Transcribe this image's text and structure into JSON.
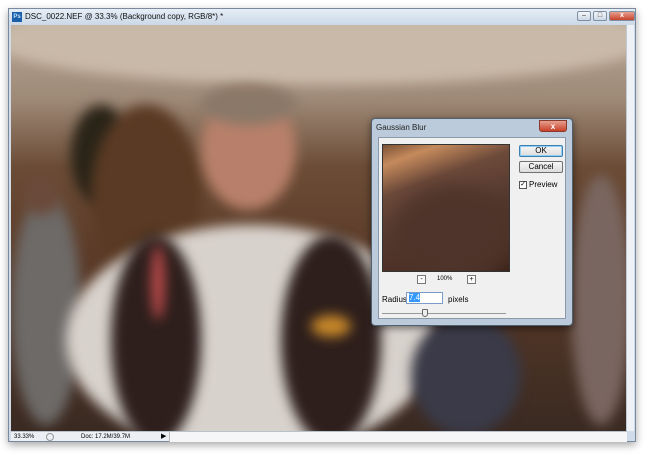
{
  "window": {
    "title": "DSC_0022.NEF @ 33.3% (Background copy, RGB/8*) *",
    "app_icon": "Ps",
    "minimize": "–",
    "maximize": "□",
    "close": "x"
  },
  "status": {
    "zoom": "33.33%",
    "doc": "Doc: 17.2M/39.7M"
  },
  "dialog": {
    "title": "Gaussian Blur",
    "close": "x",
    "ok": "OK",
    "cancel": "Cancel",
    "preview_label": "Preview",
    "preview_checked": true,
    "check": "✓",
    "zoom_out": "-",
    "zoom_in": "+",
    "zoom_level": "100%",
    "radius_label": "Radius:",
    "radius_value": "7.4",
    "units": "pixels",
    "slider_fraction": 0.35
  }
}
